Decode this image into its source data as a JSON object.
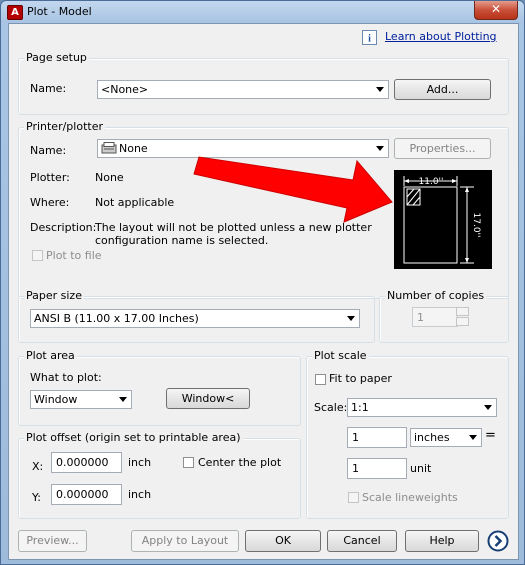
{
  "window": {
    "title": "Plot - Model"
  },
  "header": {
    "learn_link": "Learn about Plotting"
  },
  "page_setup": {
    "group_label": "Page setup",
    "name_label": "Name:",
    "name_value": "<None>",
    "add_button": "Add..."
  },
  "printer": {
    "group_label": "Printer/plotter",
    "name_label": "Name:",
    "name_value": "None",
    "properties_button": "Properties...",
    "plotter_label": "Plotter:",
    "plotter_value": "None",
    "where_label": "Where:",
    "where_value": "Not applicable",
    "description_label": "Description:",
    "description_line1": "The layout will not be plotted unless a new plotter",
    "description_line2": "configuration name is selected.",
    "plot_to_file_label": "Plot to file",
    "preview_width_label": "11.0''",
    "preview_height_label": "17.0''"
  },
  "paper_size": {
    "group_label": "Paper size",
    "value": "ANSI B (11.00 x 17.00 Inches)"
  },
  "copies": {
    "group_label": "Number of copies",
    "value": "1"
  },
  "plot_area": {
    "group_label": "Plot area",
    "what_label": "What to plot:",
    "what_value": "Window",
    "window_button": "Window<"
  },
  "plot_offset": {
    "group_label": "Plot offset (origin set to printable area)",
    "x_label": "X:",
    "x_value": "0.000000",
    "x_unit": "inch",
    "y_label": "Y:",
    "y_value": "0.000000",
    "y_unit": "inch",
    "center_label": "Center the plot"
  },
  "plot_scale": {
    "group_label": "Plot scale",
    "fit_label": "Fit to paper",
    "scale_label": "Scale:",
    "scale_value": "1:1",
    "inches_value": "1",
    "inches_unit": "inches",
    "equals": "=",
    "unit_value": "1",
    "unit_label": "unit",
    "lineweights_label": "Scale lineweights"
  },
  "footer": {
    "preview_button": "Preview...",
    "apply_button": "Apply to Layout",
    "ok_button": "OK",
    "cancel_button": "Cancel",
    "help_button": "Help"
  },
  "colors": {
    "arrow_red": "#ff0000",
    "link_blue": "#00219c"
  }
}
